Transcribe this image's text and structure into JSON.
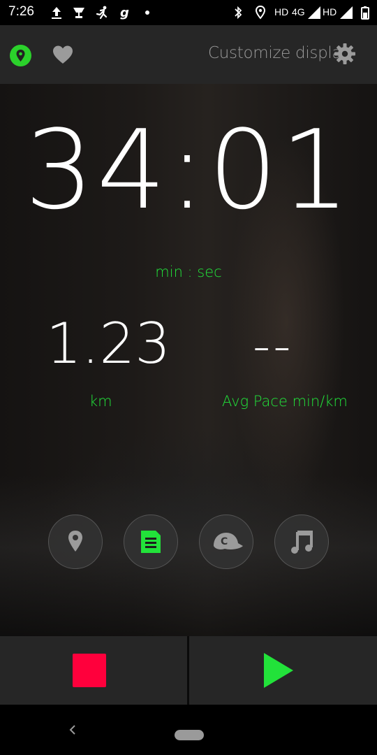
{
  "status_bar": {
    "time": "7:26",
    "network_label_1": "HD",
    "network_label_2": "4G",
    "network_label_3": "HD",
    "icons": [
      "upload-icon",
      "trophy-icon",
      "runner-icon",
      "g-app-icon",
      "dot-icon",
      "bluetooth-icon",
      "location-icon",
      "signal-icon",
      "signal-icon-2",
      "battery-icon"
    ]
  },
  "top_bar": {
    "customize_label": "Customize display",
    "icons": [
      "location-pin-icon",
      "heart-icon",
      "gear-icon"
    ]
  },
  "workout": {
    "time_value": "34:01",
    "time_unit": "min : sec",
    "distance_value": "1.23",
    "distance_unit": "km",
    "pace_value": "--",
    "pace_unit": "Avg Pace min/km"
  },
  "action_buttons": [
    {
      "icon": "map-pin-icon"
    },
    {
      "icon": "notes-icon"
    },
    {
      "icon": "coach-cap-icon"
    },
    {
      "icon": "music-icon"
    }
  ],
  "controls": {
    "stop_icon": "stop-icon",
    "play_icon": "play-icon"
  },
  "nav_bar": {
    "icons": [
      "back-icon",
      "home-pill-icon"
    ]
  },
  "colors": {
    "accent_green": "#22e23a",
    "stop_red": "#ff003c",
    "bar_gray": "#262626"
  }
}
